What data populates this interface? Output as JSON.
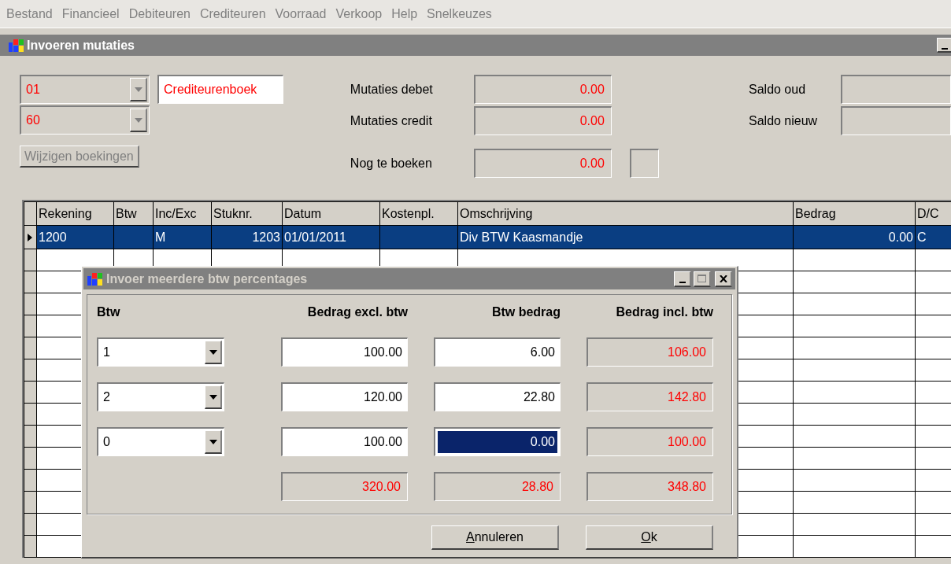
{
  "menu": [
    "Bestand",
    "Financieel",
    "Debiteuren",
    "Crediteuren",
    "Voorraad",
    "Verkoop",
    "Help",
    "Snelkeuzes"
  ],
  "window": {
    "title": "Invoeren mutaties"
  },
  "header": {
    "journal_code": "01",
    "journal_name": "Crediteurenboek",
    "period": "60",
    "change_button": {
      "label": "Wijzigen boekingen",
      "disabled": true
    },
    "totals": [
      {
        "label": "Mutaties debet",
        "value": "0.00"
      },
      {
        "label": "Mutaties credit",
        "value": "0.00"
      }
    ],
    "remaining": {
      "label": "Nog te boeken",
      "value": "0.00"
    },
    "balances": [
      {
        "label": "Saldo oud"
      },
      {
        "label": "Saldo nieuw"
      }
    ]
  },
  "table": {
    "columns": [
      {
        "label": "Rekening",
        "kind": "text"
      },
      {
        "label": "Btw",
        "kind": "text"
      },
      {
        "label": "Inc/Exc",
        "kind": "text"
      },
      {
        "label": "Stuknr.",
        "kind": "number"
      },
      {
        "label": "Datum",
        "kind": "text"
      },
      {
        "label": "Kostenpl.",
        "kind": "text"
      },
      {
        "label": "Omschrijving",
        "kind": "text"
      },
      {
        "label": "Bedrag",
        "kind": "number"
      },
      {
        "label": "D/C",
        "kind": "text"
      }
    ],
    "rows": [
      {
        "selected": true,
        "cells": [
          "1200",
          "",
          "M",
          "1203",
          "01/01/2011",
          "",
          "Div BTW Kaasmandje",
          "0.00",
          "C"
        ]
      }
    ]
  },
  "dialog": {
    "title": "Invoer meerdere btw percentages",
    "headers": [
      "Btw",
      "Bedrag excl. btw",
      "Btw bedrag",
      "Bedrag incl. btw"
    ],
    "rows": [
      {
        "btw": "1",
        "excl": "100.00",
        "btw_amount": "6.00",
        "incl": "106.00",
        "focused": false
      },
      {
        "btw": "2",
        "excl": "120.00",
        "btw_amount": "22.80",
        "incl": "142.80",
        "focused": false
      },
      {
        "btw": "0",
        "excl": "100.00",
        "btw_amount": "0.00",
        "incl": "100.00",
        "focused": true
      }
    ],
    "totals": {
      "excl": "320.00",
      "btw_amount": "28.80",
      "incl": "348.80"
    },
    "buttons": [
      {
        "label": "Annuleren",
        "underline_first": true
      },
      {
        "label": "Ok",
        "underline_first": true
      }
    ]
  }
}
